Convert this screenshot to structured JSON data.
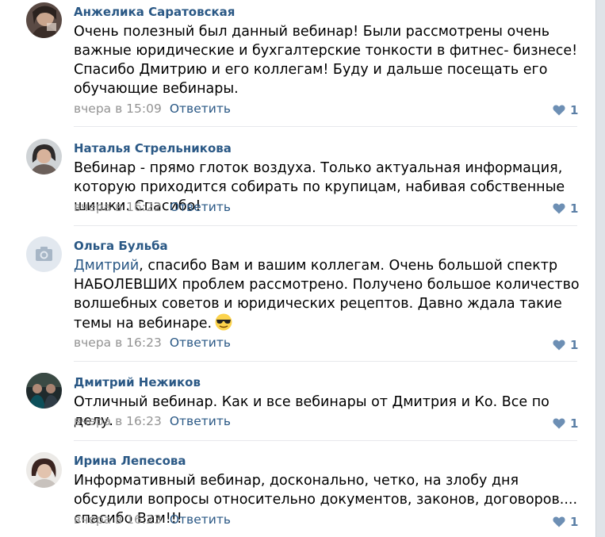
{
  "comments": [
    {
      "author": "Анжелика Саратовская",
      "text": "Очень полезный был данный вебинар! Были рассмотрены очень важные юридические и бухгалтерские тонкости в фитнес- бизнесе! Спасибо Дмитрию и его коллегам! Буду и дальше посещать его обучающие вебинары.",
      "time": "вчера в 15:09",
      "reply": "Ответить",
      "likes": "1"
    },
    {
      "author": "Наталья Стрельникова",
      "text": "Вебинар - прямо глоток воздуха. Только актуальная информация, которую приходится собирать по крупицам, набивая собственные шишки. Спасибо!",
      "time": "вчера в 16:22",
      "reply": "Ответить",
      "likes": "1"
    },
    {
      "author": "Ольга Бульба",
      "mention": "Дмитрий",
      "text": ", спасибо Вам и вашим коллегам. Очень большой спектр НАБОЛЕВШИХ проблем рассмотрено. Получено большое количество волшебных советов и юридических рецептов. Давно ждала такие темы на вебинаре.",
      "emoji": "sunglasses-emoji",
      "time": "вчера в 16:23",
      "reply": "Ответить",
      "likes": "1"
    },
    {
      "author": "Дмитрий Нежиков",
      "text": "Отличный вебинар. Как и все вебинары от Дмитрия и Ко. Все по делу.",
      "time": "вчера в 16:23",
      "reply": "Ответить",
      "likes": "1"
    },
    {
      "author": "Ирина Лепесова",
      "text": "Информативный вебинар, досконально, четко, на злобу дня обсудили вопросы относительно документов, законов, договоров.... спасибо Вам!!!",
      "time": "вчера в 16:23",
      "reply": "Ответить",
      "likes": "1"
    }
  ],
  "colors": {
    "link": "#2a5885",
    "meta": "#939393",
    "like": "#5b7fa6",
    "divider": "#e7e8ec"
  },
  "icons": {
    "like": "heart-icon",
    "placeholder_avatar": "camera-icon"
  }
}
